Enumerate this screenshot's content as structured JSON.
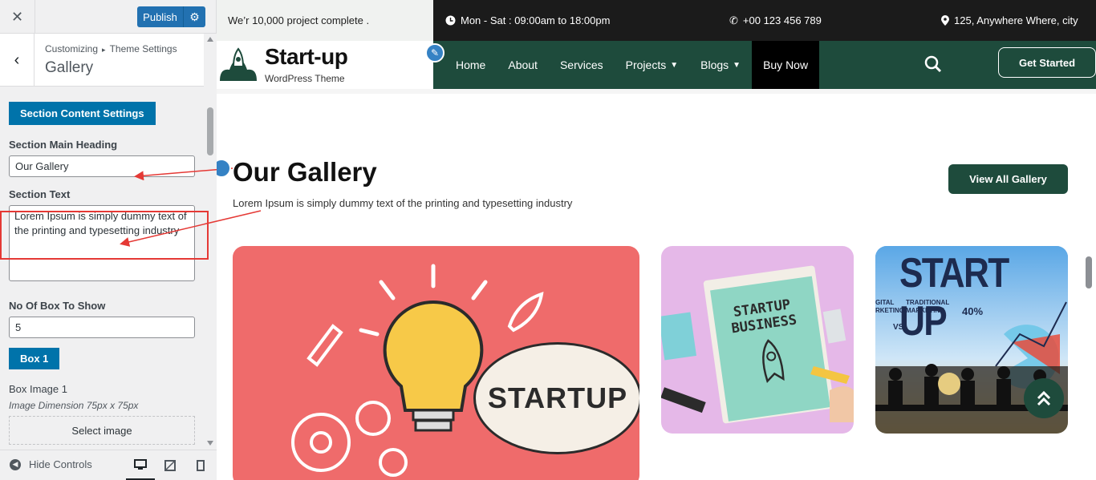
{
  "customizer": {
    "publish_label": "Publish",
    "breadcrumb": [
      "Customizing",
      "Theme Settings"
    ],
    "panel_title": "Gallery",
    "section_button": "Section Content Settings",
    "heading_label": "Section Main Heading",
    "heading_value": "Our Gallery",
    "text_label": "Section Text",
    "text_value": "Lorem Ipsum is simply dummy text of the printing and typesetting industry",
    "boxes_label": "No Of Box To Show",
    "boxes_value": "5",
    "box1_button": "Box 1",
    "box_image_label": "Box Image 1",
    "image_hint": "Image Dimension 75px x 75px",
    "select_image": "Select image",
    "hide_controls": "Hide Controls"
  },
  "site": {
    "topbar_left": "We’r 10,000 project complete .",
    "hours": "Mon - Sat : 09:00am to 18:00pm",
    "phone": "+00 123 456 789",
    "address": "125, Anywhere Where, city",
    "logo_title": "Start-up",
    "logo_sub": "WordPress Theme",
    "nav": [
      "Home",
      "About",
      "Services",
      "Projects",
      "Blogs",
      "Buy Now"
    ],
    "get_started": "Get Started",
    "gallery_heading": "Our Gallery",
    "gallery_text": "Lorem Ipsum is simply dummy text of the printing and typesetting industry",
    "view_all": "View All Gallery",
    "card1_word": "STARTUP",
    "card2_text": [
      "STARTUP",
      "BUSINESS"
    ],
    "card3_title": "START UP",
    "card3_labels": [
      "GITAL",
      "RKETING",
      "TRADITIONAL",
      "MARKETING",
      "VS",
      "40%"
    ]
  },
  "colors": {
    "wp_blue": "#2271b1",
    "green": "#1e4b3c",
    "highlight": "#e53935"
  }
}
